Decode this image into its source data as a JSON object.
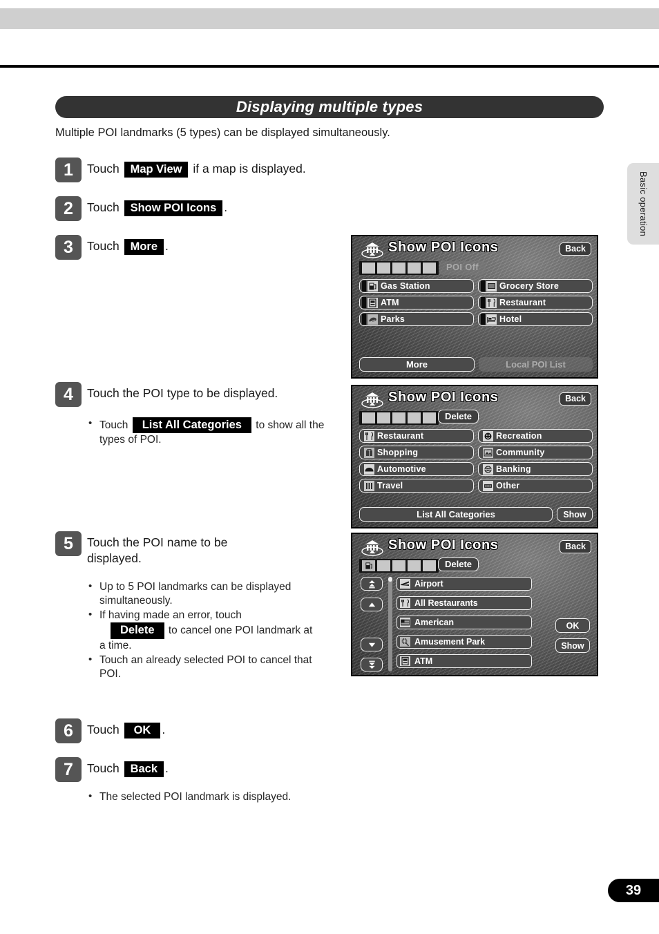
{
  "document": {
    "section_title": "Displaying multiple types",
    "intro": "Multiple POI landmarks (5 types) can be displayed simultaneously.",
    "side_tab": "Basic operation",
    "page_number": "39"
  },
  "steps": [
    {
      "num": "1",
      "pre": "Touch",
      "key": "Map View",
      "post": "if a map is displayed."
    },
    {
      "num": "2",
      "pre": "Touch",
      "key": "Show POI Icons",
      "post": "."
    },
    {
      "num": "3",
      "pre": "Touch",
      "key": "More",
      "post": "."
    },
    {
      "num": "4",
      "pre": "Touch the POI type to be displayed.",
      "key": "",
      "post": ""
    },
    {
      "num": "5",
      "pre": "Touch the POI name to be displayed.",
      "key": "",
      "post": ""
    },
    {
      "num": "6",
      "pre": "Touch",
      "key": "OK",
      "post": "."
    },
    {
      "num": "7",
      "pre": "Touch",
      "key": "Back",
      "post": "."
    }
  ],
  "bullets": {
    "step4": {
      "pre": "Touch",
      "key": "List All Categories",
      "post": "to show all the types of POI."
    },
    "step5_a": "Up to 5 POI landmarks can be displayed simultaneously.",
    "step5_b_pre": "If having made an error, touch",
    "step5_b_key": "Delete",
    "step5_b_post": "to cancel one POI landmark at a time.",
    "step5_c": "Touch an already selected POI to cancel that POI.",
    "step7": "The selected POI landmark is displayed."
  },
  "nav_screens": [
    {
      "id": "nav1",
      "title": "Show POI Icons",
      "title_icon": "bank-temple-icon",
      "back_label": "Back",
      "slots": [
        {
          "state": "empty",
          "icon": ""
        },
        {
          "state": "empty",
          "icon": ""
        },
        {
          "state": "empty",
          "icon": ""
        },
        {
          "state": "empty",
          "icon": ""
        },
        {
          "state": "empty",
          "icon": ""
        }
      ],
      "status_label": "POI Off",
      "status_disabled": true,
      "grid": [
        {
          "label": "Gas Station",
          "icon": "gas-pump-icon",
          "marker": true
        },
        {
          "label": "Grocery Store",
          "icon": "grocery-cart-icon",
          "marker": true
        },
        {
          "label": "ATM",
          "icon": "atm-icon",
          "marker": true
        },
        {
          "label": "Restaurant",
          "icon": "restaurant-icon",
          "marker": true
        },
        {
          "label": "Parks",
          "icon": "parks-icon",
          "marker": true
        },
        {
          "label": "Hotel",
          "icon": "hotel-bed-icon",
          "marker": true
        }
      ],
      "bottom_primary": "More",
      "bottom_secondary": "Local POI List",
      "bottom_secondary_disabled": true
    },
    {
      "id": "nav2",
      "title": "Show POI Icons",
      "title_icon": "bank-temple-icon",
      "back_label": "Back",
      "slots": [
        {
          "state": "empty",
          "icon": ""
        },
        {
          "state": "empty",
          "icon": ""
        },
        {
          "state": "empty",
          "icon": ""
        },
        {
          "state": "empty",
          "icon": ""
        },
        {
          "state": "empty",
          "icon": ""
        }
      ],
      "delete_label": "Delete",
      "grid": [
        {
          "label": "Restaurant",
          "icon": "restaurant-icon",
          "marker": false
        },
        {
          "label": "Recreation",
          "icon": "recreation-icon",
          "marker": false
        },
        {
          "label": "Shopping",
          "icon": "shopping-bag-icon",
          "marker": false
        },
        {
          "label": "Community",
          "icon": "community-icon",
          "marker": false
        },
        {
          "label": "Automotive",
          "icon": "car-icon",
          "marker": false
        },
        {
          "label": "Banking",
          "icon": "banking-icon",
          "marker": false
        },
        {
          "label": "Travel",
          "icon": "suitcase-icon",
          "marker": false
        },
        {
          "label": "Other",
          "icon": "other-icon",
          "marker": false
        }
      ],
      "bottom_primary": "List All Categories",
      "bottom_small": "Show"
    },
    {
      "id": "nav3",
      "title": "Show POI Icons",
      "title_icon": "bank-temple-icon",
      "back_label": "Back",
      "slots": [
        {
          "state": "filled",
          "icon": "gas-pump-icon"
        },
        {
          "state": "empty",
          "icon": ""
        },
        {
          "state": "empty",
          "icon": ""
        },
        {
          "state": "empty",
          "icon": ""
        },
        {
          "state": "empty",
          "icon": ""
        }
      ],
      "delete_label": "Delete",
      "scroll_buttons": [
        "page-up-icon",
        "scroll-up-icon",
        "scroll-down-icon",
        "page-down-icon"
      ],
      "list": [
        {
          "label": "Airport",
          "icon": "airplane-icon"
        },
        {
          "label": "All Restaurants",
          "icon": "restaurant-icon"
        },
        {
          "label": "American",
          "icon": "american-flag-icon"
        },
        {
          "label": "Amusement Park",
          "icon": "amusement-park-icon"
        },
        {
          "label": "ATM",
          "icon": "atm-icon"
        }
      ],
      "ok_label": "OK",
      "show_label": "Show"
    }
  ],
  "colors": {
    "title_bar": "#333333",
    "step_badge": "#555555",
    "key_bg": "#000000",
    "top_band": "#cfcfcf",
    "side_tab": "#dedede"
  }
}
